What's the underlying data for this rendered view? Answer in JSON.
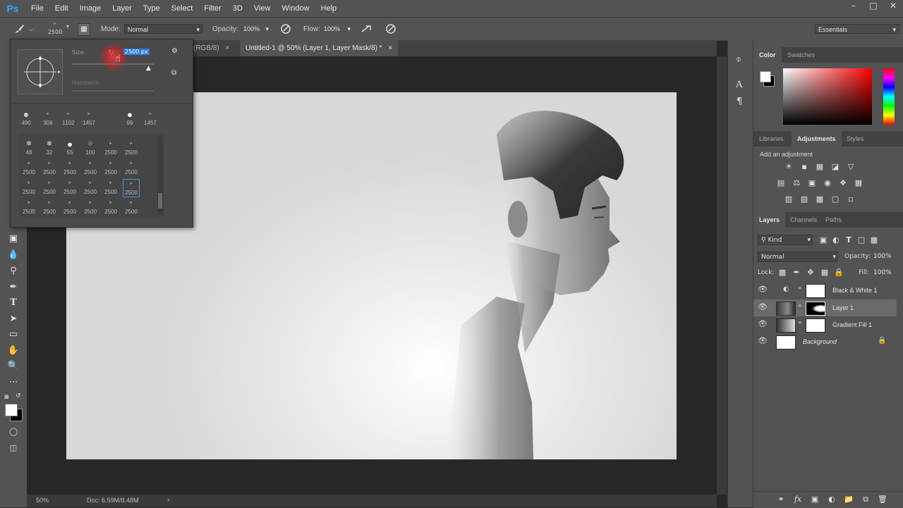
{
  "app": {
    "logo": "Ps"
  },
  "menu": [
    "File",
    "Edit",
    "Image",
    "Layer",
    "Type",
    "Select",
    "Filter",
    "3D",
    "View",
    "Window",
    "Help"
  ],
  "window_controls": [
    "–",
    "□",
    "✕"
  ],
  "options_bar": {
    "brush_size": "2500",
    "mode_label": "Mode:",
    "mode_value": "Normal",
    "opacity_label": "Opacity:",
    "opacity_value": "100%",
    "flow_label": "Flow:",
    "flow_value": "100%",
    "workspace": "Essentials"
  },
  "tabs": [
    {
      "label": "(RGB/8)",
      "close": "×"
    },
    {
      "label": "Untitled-1 @ 50% (Layer 1, Layer Mask/8) *",
      "close": "×"
    }
  ],
  "brush_picker": {
    "size_label": "Size:",
    "size_value": "2500 px",
    "hardness_label": "Hardness:",
    "top_row": [
      "490",
      "306",
      "1102",
      "1457",
      "99",
      "1457"
    ],
    "grid": [
      [
        "48",
        "32",
        "55",
        "100",
        "2500",
        "2500"
      ],
      [
        "2500",
        "2500",
        "2500",
        "2500",
        "2500",
        "2500"
      ],
      [
        "2500",
        "2500",
        "2500",
        "2500",
        "2500",
        "2500"
      ],
      [
        "2500",
        "2500",
        "2500",
        "2500",
        "2500",
        "2500"
      ]
    ]
  },
  "status": {
    "zoom": "50%",
    "doc": "Doc: 6.59M/8.48M"
  },
  "color_panel": {
    "tabs": [
      "Color",
      "Swatches"
    ]
  },
  "adjustments_panel": {
    "tabs": [
      "Libraries",
      "Adjustments",
      "Styles"
    ],
    "add_label": "Add an adjustment",
    "icons_row1": [
      "brightness-icon",
      "levels-icon",
      "curves-icon",
      "exposure-icon",
      "vibrance-icon"
    ],
    "icons_row2": [
      "hue-saturation-icon",
      "color-balance-icon",
      "black-white-icon",
      "photo-filter-icon",
      "channel-mixer-icon",
      "color-lookup-icon"
    ],
    "icons_row3": [
      "invert-icon",
      "posterize-icon",
      "threshold-icon",
      "selective-color-icon",
      "gradient-map-icon"
    ]
  },
  "layers_panel": {
    "tabs": [
      "Layers",
      "Channels",
      "Paths"
    ],
    "kind_label": "Kind",
    "blend_mode": "Normal",
    "opacity_label": "Opacity:",
    "opacity_value": "100%",
    "lock_label": "Lock:",
    "fill_label": "Fill:",
    "fill_value": "100%",
    "layers": [
      {
        "name": "Black & White 1"
      },
      {
        "name": "Layer 1"
      },
      {
        "name": "Gradient Fill 1"
      },
      {
        "name": "Background"
      }
    ]
  },
  "colors": {
    "ps_blue": "#31a8ff",
    "selection": "#2d7fe0",
    "panel_bg": "#535353"
  }
}
